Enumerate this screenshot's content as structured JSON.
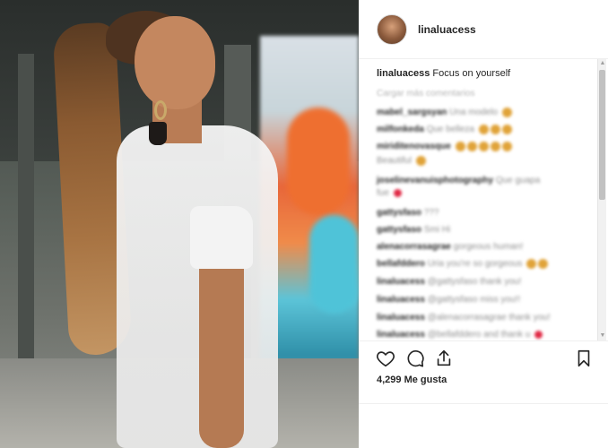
{
  "post": {
    "username": "linaluacess",
    "caption_user": "linaluacess",
    "caption_text": "Focus on yourself",
    "load_more": "Cargar más comentarios",
    "likes": "4,299 Me gusta"
  },
  "comments": [
    {
      "user": "mabel_sargsyan",
      "text": "Una modelo"
    },
    {
      "user": "milfonkeda",
      "text": "Que belleza"
    },
    {
      "user": "miriditenovasque",
      "text": ""
    },
    {
      "user": "",
      "text": "Beautiful"
    },
    {
      "user": "joselinevanuisphotography",
      "text": "Que guapa"
    },
    {
      "user": "",
      "text": "fue"
    },
    {
      "user": "gattysfaso",
      "text": "???"
    },
    {
      "user": "gattysfaso",
      "text": "Smi Hi"
    },
    {
      "user": "alenacorrasagrae",
      "text": "gorgeous human!"
    },
    {
      "user": "bellafddero",
      "text": "Uria you're so gorgeous"
    },
    {
      "user": "linaluacess",
      "text": "@gattysfaso thank you!"
    },
    {
      "user": "linaluacess",
      "text": "@gattysfaso miss you!!"
    },
    {
      "user": "linaluacess",
      "text": "@alenacorrasagrae thank you!"
    },
    {
      "user": "linaluacess",
      "text": "@bellafddero and thank u"
    }
  ],
  "icons": [
    "heart-icon",
    "comment-icon",
    "share-icon",
    "bookmark-icon"
  ]
}
